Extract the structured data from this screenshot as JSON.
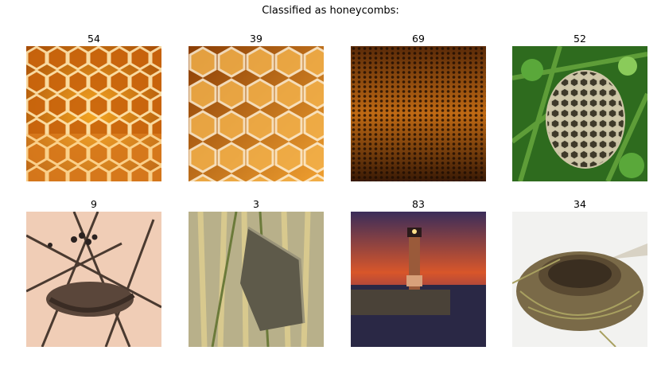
{
  "figure": {
    "title": "Classified as honeycombs:"
  },
  "grid": [
    {
      "label": "54",
      "subject": "honeycomb-closeup"
    },
    {
      "label": "39",
      "subject": "honeycomb-golden"
    },
    {
      "label": "69",
      "subject": "honeycomb-perspective"
    },
    {
      "label": "52",
      "subject": "wasp-nest-in-grass"
    },
    {
      "label": "9",
      "subject": "bird-nest-in-branches"
    },
    {
      "label": "3",
      "subject": "bird-nest-in-reeds"
    },
    {
      "label": "83",
      "subject": "lighthouse-at-sunset"
    },
    {
      "label": "34",
      "subject": "bird-nest-on-white"
    }
  ]
}
